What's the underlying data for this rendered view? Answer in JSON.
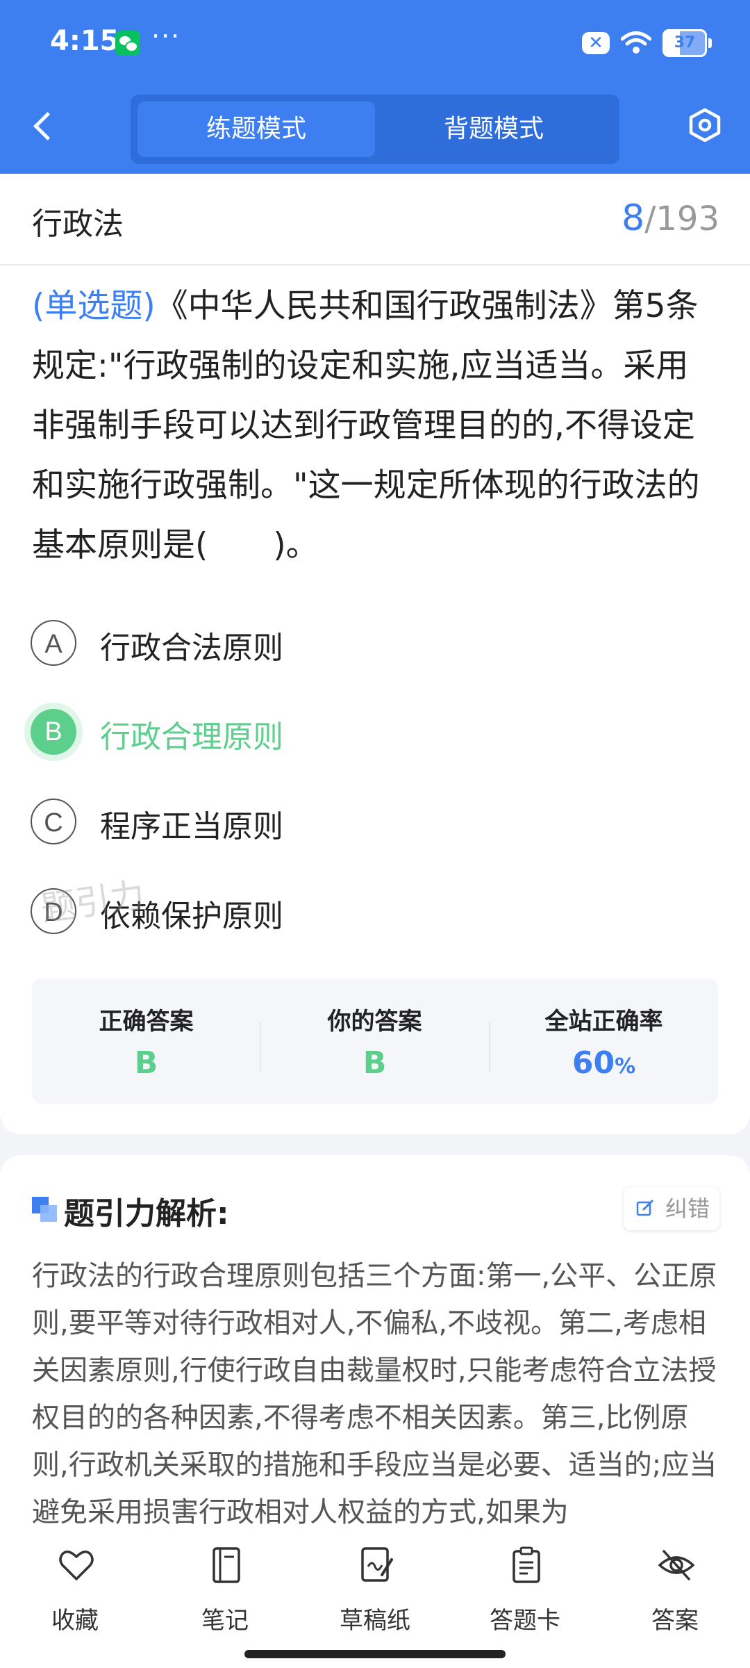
{
  "status_bar": {
    "time": "4:15",
    "dots": "···",
    "battery": "37"
  },
  "header": {
    "tabs": [
      {
        "label": "练题模式"
      },
      {
        "label": "背题模式"
      }
    ]
  },
  "subject": {
    "title": "行政法",
    "current": "8",
    "total": "/193"
  },
  "question": {
    "type": "(单选题)",
    "text": "《中华人民共和国行政强制法》第5条规定:\"行政强制的设定和实施,应当适当。采用非强制手段可以达到行政管理目的的,不得设定和实施行政强制。\"这一规定所体现的行政法的基本原则是(　　)。"
  },
  "options": [
    {
      "letter": "A",
      "text": "行政合法原则",
      "correct": false
    },
    {
      "letter": "B",
      "text": "行政合理原则",
      "correct": true
    },
    {
      "letter": "C",
      "text": "程序正当原则",
      "correct": false
    },
    {
      "letter": "D",
      "text": "依赖保护原则",
      "correct": false
    }
  ],
  "watermark": "题引力",
  "answer_summary": {
    "correct_label": "正确答案",
    "correct_value": "B",
    "yours_label": "你的答案",
    "yours_value": "B",
    "rate_label": "全站正确率",
    "rate_value": "60",
    "rate_unit": "%"
  },
  "analysis": {
    "title": "题引力解析:",
    "report_label": "纠错",
    "text": "行政法的行政合理原则包括三个方面:第一,公平、公正原则,要平等对待行政相对人,不偏私,不歧视。第二,考虑相关因素原则,行使行政自由裁量权时,只能考虑符合立法授权目的的各种因素,不得考虑不相关因素。第三,比例原则,行政机关采取的措施和手段应当是必要、适当的;应当避免采用损害行政相对人权益的方式,如果为"
  },
  "bottom_nav": [
    {
      "label": "收藏",
      "icon": "heart-icon"
    },
    {
      "label": "笔记",
      "icon": "notebook-icon"
    },
    {
      "label": "草稿纸",
      "icon": "draft-paper-icon"
    },
    {
      "label": "答题卡",
      "icon": "answer-card-icon"
    },
    {
      "label": "答案",
      "icon": "eye-off-icon"
    }
  ],
  "colors": {
    "primary": "#3d7ff0",
    "correct": "#5ccf8c"
  }
}
